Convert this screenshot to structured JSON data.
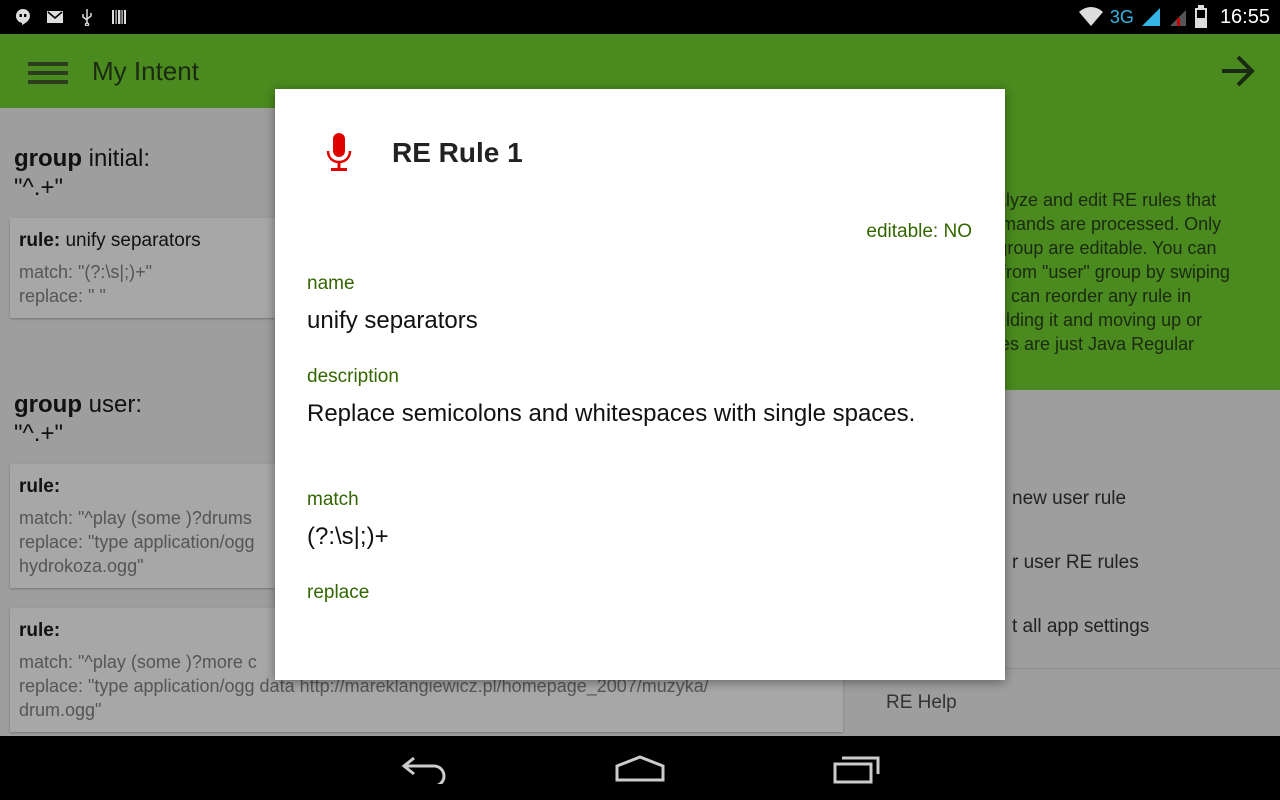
{
  "status_bar": {
    "network": "3G",
    "time": "16:55",
    "icons": [
      "hangouts-icon",
      "gmail-icon",
      "usb-icon",
      "barcode-icon",
      "wifi-icon",
      "signal-icon",
      "battery-icon"
    ]
  },
  "app_bar": {
    "title": "My Intent"
  },
  "background": {
    "groups": [
      {
        "keyword": "group",
        "name": "initial:",
        "pattern": "\"^.+\""
      },
      {
        "keyword": "group",
        "name": "user:",
        "pattern": "\"^.+\""
      }
    ],
    "cards": [
      {
        "label": "rule:",
        "name": "unify separators",
        "lines": [
          "match: \"(?:\\s|;)+\"",
          "replace: \" \""
        ]
      },
      {
        "label": "rule:",
        "name": "",
        "lines": [
          "match: \"^play (some )?drums",
          "replace: \"type application/ogg",
          "hydrokoza.ogg\""
        ]
      },
      {
        "label": "rule:",
        "name": "",
        "lines": [
          "match: \"^play (some )?more c",
          "replace: \"type application/ogg data http://mareklangiewicz.pl/homepage_2007/muzyka/",
          "drum.ogg\""
        ]
      }
    ],
    "help_lines": [
      "nalyze and edit RE rules that",
      "mmands are processed. Only",
      "\" group are editable. You can",
      "e from \"user\" group by swiping",
      "ou can reorder any rule in",
      "holding it and moving up or",
      "ules are just Java Regular"
    ],
    "side_items": [
      "new user rule",
      "r user RE rules",
      "t all app settings"
    ],
    "side_help": "RE Help"
  },
  "dialog": {
    "title": "RE Rule 1",
    "editable": "editable: NO",
    "fields": [
      {
        "label": "name",
        "value": "unify separators"
      },
      {
        "label": "description",
        "value": "Replace semicolons and whitespaces with single spaces."
      },
      {
        "label": "match",
        "value": "(?:\\s|;)+"
      },
      {
        "label": "replace",
        "value": ""
      }
    ],
    "accent_color": "#336600",
    "icon_color": "#e00000"
  },
  "colors": {
    "app_bar": "#4a8a1e",
    "dim_background": "#9e9e9e"
  }
}
